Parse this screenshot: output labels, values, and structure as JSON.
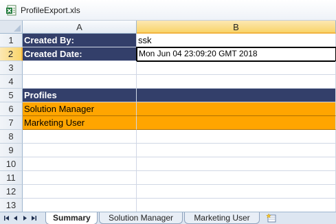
{
  "window": {
    "title": "ProfileExport.xls",
    "icon": "excel-file-icon"
  },
  "sheet": {
    "columns": [
      "A",
      "B"
    ],
    "selected_column": "B",
    "rows": [
      "1",
      "2",
      "3",
      "4",
      "5",
      "6",
      "7",
      "8",
      "9",
      "10",
      "11",
      "12",
      "13"
    ],
    "selected_row": "2",
    "cells": {
      "A1": "Created By:",
      "B1": "ssk",
      "A2": "Created Date:",
      "B2": "Mon Jun 04 23:09:20 GMT 2018",
      "A5": "Profiles",
      "A6": "Solution Manager",
      "A7": "Marketing User"
    },
    "colors": {
      "header_fill": "#333f6a",
      "profile_fill": "#ffa500",
      "selection_accent": "#f9d46a"
    }
  },
  "tabs": {
    "items": [
      "Summary",
      "Solution Manager",
      "Marketing User"
    ],
    "active": "Summary",
    "nav_icons": [
      "first-sheet-icon",
      "prev-sheet-icon",
      "next-sheet-icon",
      "last-sheet-icon"
    ],
    "insert_icon": "insert-sheet-icon"
  }
}
